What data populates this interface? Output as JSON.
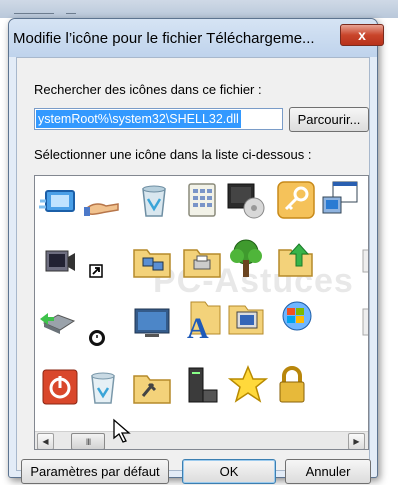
{
  "dialog": {
    "title": "Modifie l’icône pour le fichier Téléchargeme...",
    "close_label": "x",
    "search_label": "Rechercher des icônes dans ce fichier :",
    "file_path_value": "ystemRoot%\\system32\\SHELL32.dll",
    "browse_label": "Parcourir...",
    "select_label": "Sélectionner une icône dans la liste ci-dessous :",
    "watermark_text": "PC-Astuces",
    "defaults_label": "Paramètres par défaut",
    "ok_label": "OK",
    "cancel_label": "Annuler"
  },
  "icon_list": {
    "rows": [
      [
        "display-properties-icon",
        "sharing-hand-icon",
        "recycle-bin-full-icon",
        "calculator-grid-icon",
        "monitor-disc-icon",
        "key-icon",
        "window-computer-icon"
      ],
      [
        "speaker-computer-icon",
        "shortcut-arrow-icon",
        "folder-network-icon",
        "folder-printer-icon",
        "tree-icon",
        "folder-upload-icon",
        "partial-icon"
      ],
      [
        "usb-drive-icon",
        "clock-badge-icon",
        "desktop-monitor-icon",
        "font-folder-icon",
        "computer-monitor-icon",
        "windows-globe-icon",
        "partial-icon"
      ],
      [
        "power-button-icon",
        "recycle-bin-empty-icon",
        "folder-tools-icon",
        "server-icon",
        "star-icon",
        "padlock-icon",
        "partial-icon"
      ]
    ],
    "scroll_thumb_text": "III"
  },
  "colors": {
    "title_bar": "#bfd3ec",
    "close_button": "#c9452b",
    "selection": "#3399ff",
    "dialog_background": "#f0f0f0"
  }
}
